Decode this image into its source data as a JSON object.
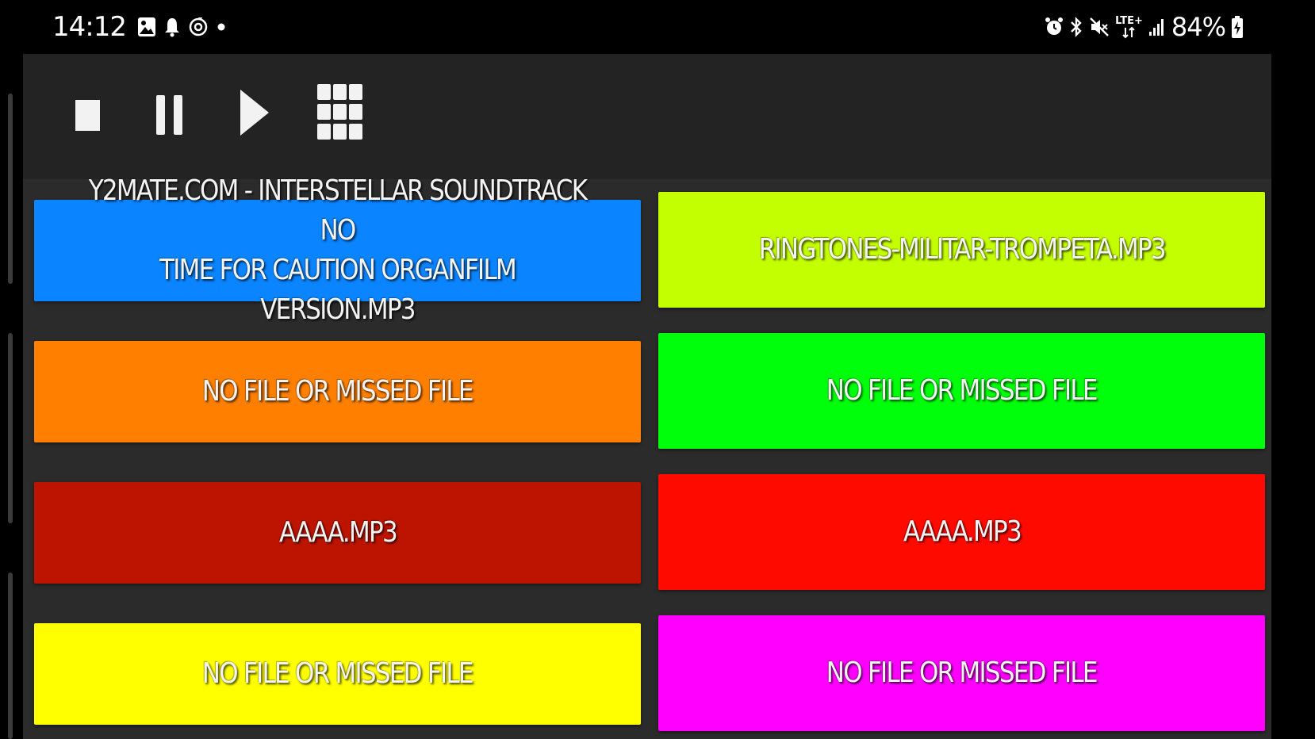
{
  "status_bar": {
    "time": "14:12",
    "network_badge_top": "LTE+",
    "battery_percent": "84%",
    "left_icons": [
      "gallery-icon",
      "notification-bell-icon",
      "media-sync-icon",
      "dot-indicator-icon"
    ],
    "right_icons": [
      "alarm-icon",
      "bluetooth-icon",
      "mute-icon",
      "lte-data-icon",
      "signal-bars-icon",
      "battery-charging-icon"
    ]
  },
  "toolbar": {
    "buttons": [
      {
        "name": "stop",
        "icon": "stop-icon"
      },
      {
        "name": "pause",
        "icon": "pause-icon"
      },
      {
        "name": "play",
        "icon": "play-icon"
      },
      {
        "name": "grid",
        "icon": "grid-icon"
      }
    ],
    "icon_color": "#f2f2f2"
  },
  "pads": [
    {
      "label": "Y2MATE.COM - INTERSTELLAR SOUNDTRACK  NO\nTIME FOR CAUTION ORGANFILM VERSION.MP3",
      "color": "#0a84ff"
    },
    {
      "label": "RINGTONES-MILITAR-TROMPETA.MP3",
      "color": "#c4ff00"
    },
    {
      "label": "NO FILE OR MISSED FILE",
      "color": "#ff7f00"
    },
    {
      "label": "NO FILE OR MISSED FILE",
      "color": "#00ff0a"
    },
    {
      "label": "AAAA.MP3",
      "color": "#bc1400"
    },
    {
      "label": "AAAA.MP3",
      "color": "#ff0a00"
    },
    {
      "label": "NO FILE OR MISSED FILE",
      "color": "#ffff00"
    },
    {
      "label": "NO FILE OR MISSED FILE",
      "color": "#ff00ff"
    }
  ],
  "colors": {
    "app_background": "#2b2b2b",
    "toolbar_background": "#232323",
    "status_bar_background": "#000000"
  }
}
